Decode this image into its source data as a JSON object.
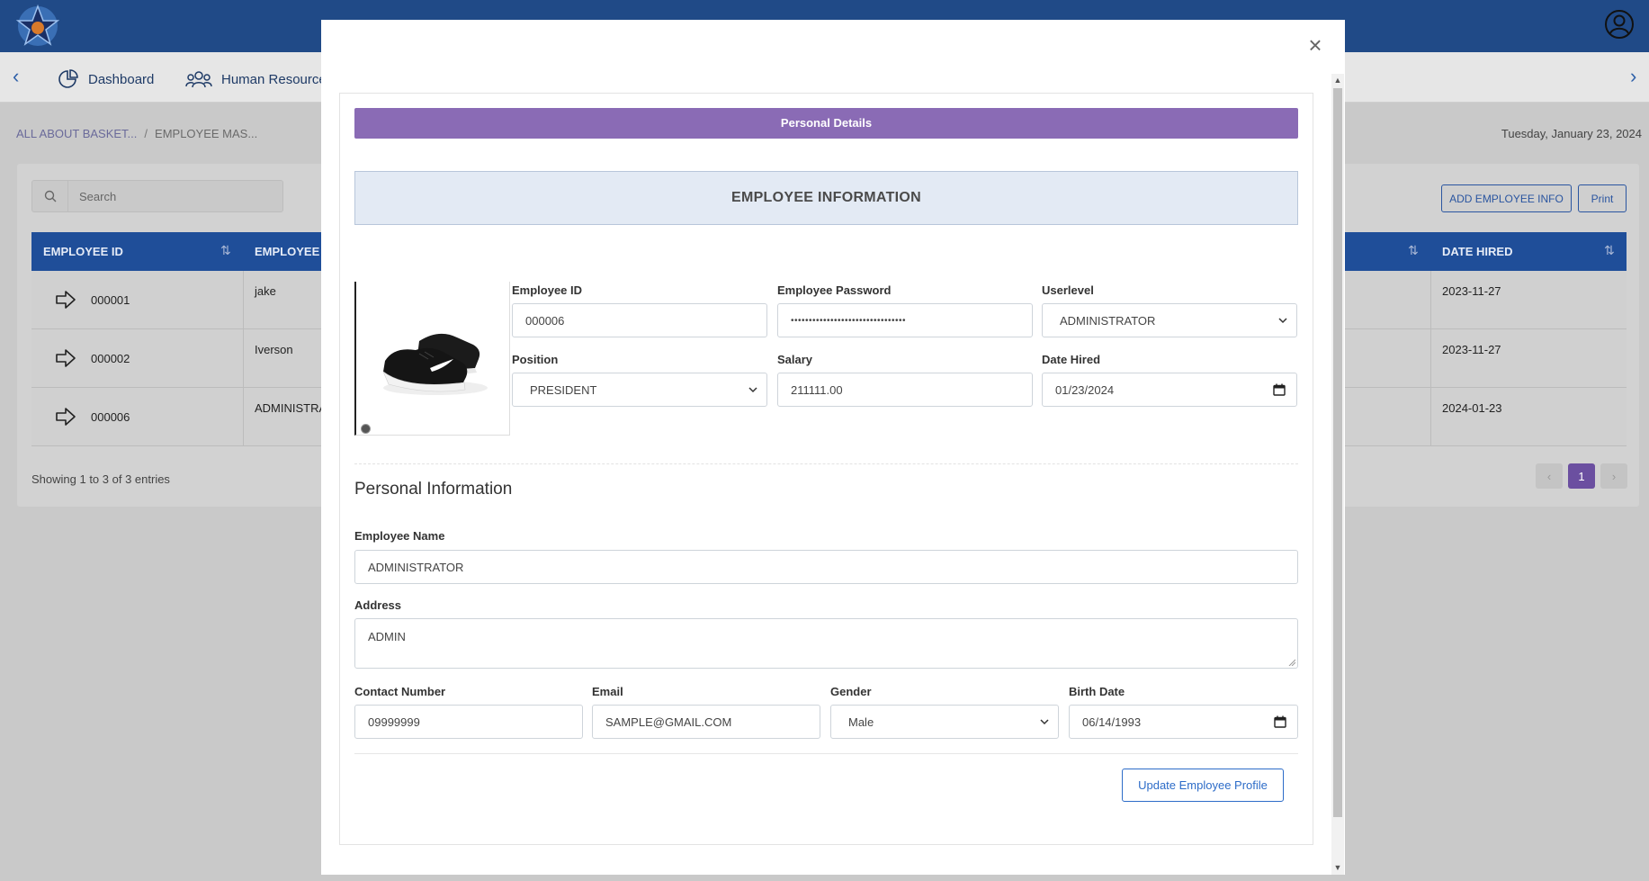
{
  "nav": {
    "dashboard_label": "Dashboard",
    "hr_label": "Human Resource"
  },
  "breadcrumb": {
    "root": "ALL ABOUT BASKET...",
    "separator": "/",
    "current": "EMPLOYEE MAS..."
  },
  "date_display": "Tuesday, January 23, 2024",
  "table": {
    "search_placeholder": "Search",
    "add_button": "ADD EMPLOYEE INFO",
    "print_button": "Print",
    "columns": [
      "EMPLOYEE ID",
      "EMPLOYEE N",
      "DATE HIRED"
    ],
    "rows": [
      {
        "id": "000001",
        "name": "jake",
        "date_hired": "2023-11-27"
      },
      {
        "id": "000002",
        "name": "Iverson",
        "date_hired": "2023-11-27"
      },
      {
        "id": "000006",
        "name": "ADMINISTRA",
        "date_hired": "2024-01-23"
      }
    ],
    "showing": "Showing 1 to 3 of 3 entries",
    "page_prev": "‹",
    "page_current": "1",
    "page_next": "›"
  },
  "modal": {
    "close_glyph": "×",
    "personal_details_bar": "Personal Details",
    "employee_info_heading": "EMPLOYEE INFORMATION",
    "fields": {
      "employee_id": {
        "label": "Employee ID",
        "value": "000006"
      },
      "password": {
        "label": "Employee Password",
        "value": "••••••••••••••••••••••••••••••••"
      },
      "userlevel": {
        "label": "Userlevel",
        "value": "ADMINISTRATOR"
      },
      "position": {
        "label": "Position",
        "value": "PRESIDENT"
      },
      "salary": {
        "label": "Salary",
        "value": "211111.00"
      },
      "date_hired": {
        "label": "Date Hired",
        "value": "01/23/2024"
      }
    },
    "personal_info_title": "Personal Information",
    "personal": {
      "name": {
        "label": "Employee Name",
        "value": "ADMINISTRATOR"
      },
      "address": {
        "label": "Address",
        "value": "ADMIN"
      },
      "contact": {
        "label": "Contact Number",
        "value": "09999999"
      },
      "email": {
        "label": "Email",
        "value": "SAMPLE@GMAIL.COM"
      },
      "gender": {
        "label": "Gender",
        "value": "Male"
      },
      "birth_date": {
        "label": "Birth Date",
        "value": "06/14/1993"
      }
    },
    "update_button": "Update Employee Profile"
  },
  "colors": {
    "topbar": "#204a87",
    "table_header": "#1f4e99",
    "accent_purple": "#8a6bb5",
    "link_blue": "#2d6cc8"
  }
}
